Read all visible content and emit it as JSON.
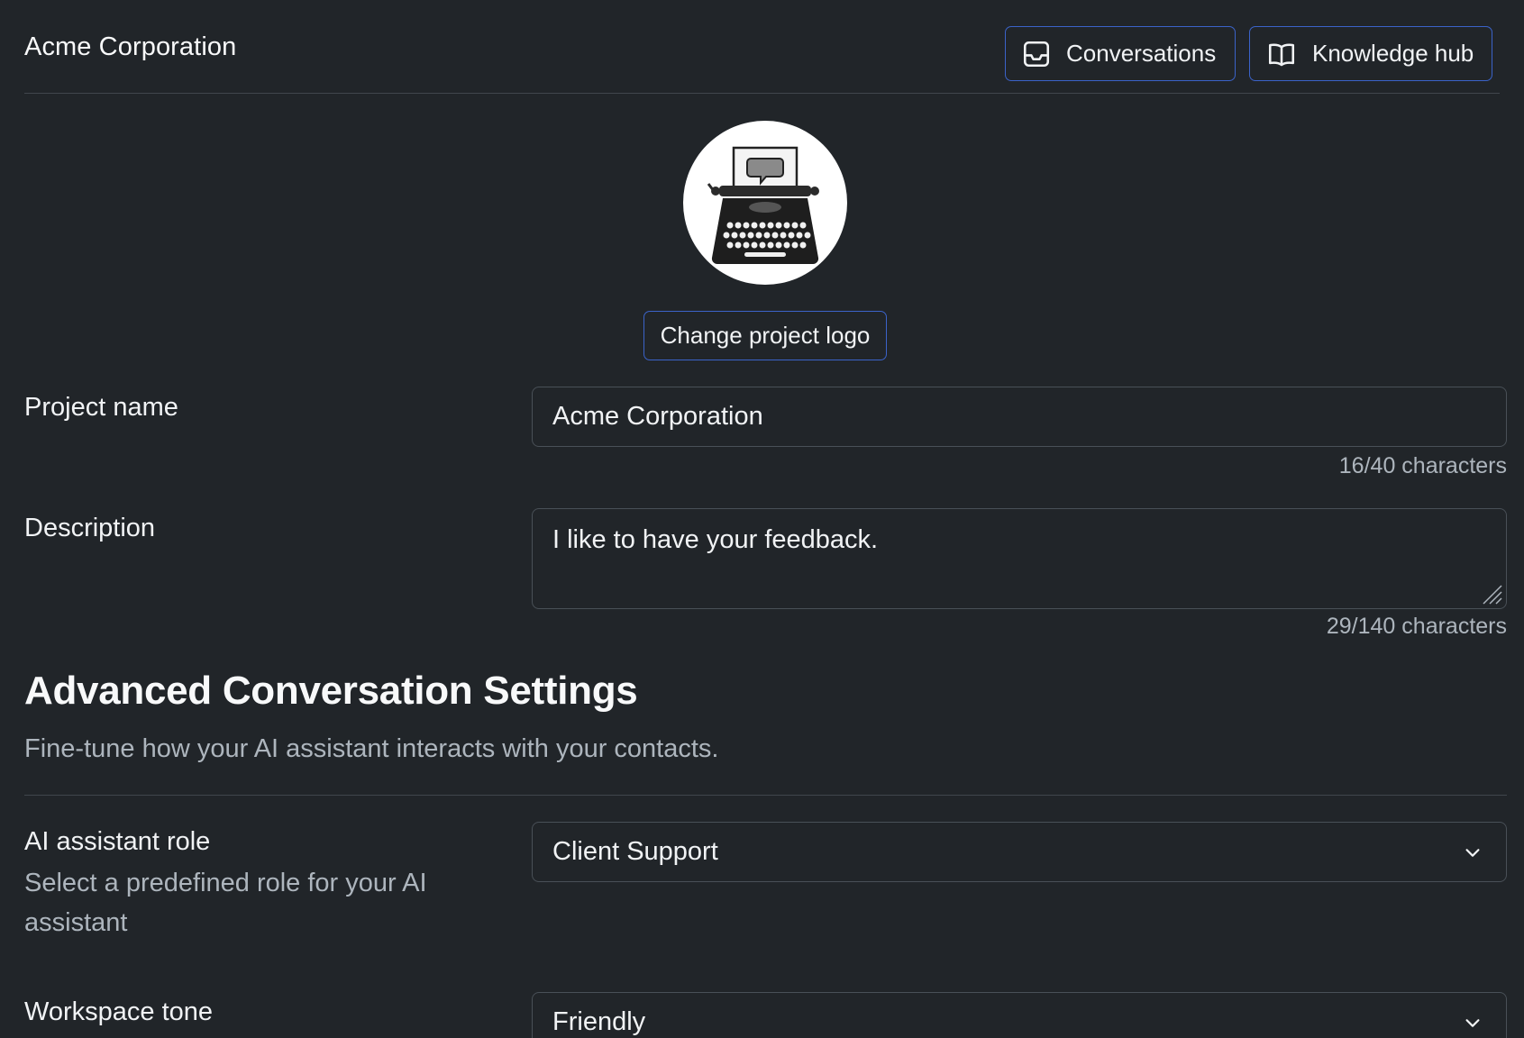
{
  "header": {
    "brand": "Acme Corporation",
    "nav": [
      {
        "label": "Conversations",
        "icon": "inbox-icon"
      },
      {
        "label": "Knowledge hub",
        "icon": "book-open-icon"
      }
    ]
  },
  "logo": {
    "icon": "typewriter-icon",
    "change_label": "Change project logo"
  },
  "project_name": {
    "label": "Project name",
    "value": "Acme Corporation",
    "counter": "16/40 characters"
  },
  "description": {
    "label": "Description",
    "value": "I like to have your feedback.",
    "counter": "29/140 characters"
  },
  "advanced": {
    "title": "Advanced Conversation Settings",
    "subtitle": "Fine-tune how your AI assistant interacts with your contacts.",
    "role": {
      "label": "AI assistant role",
      "help": "Select a predefined role for your AI assistant",
      "selected": "Client Support"
    },
    "tone": {
      "label": "Workspace tone",
      "selected": "Friendly"
    }
  },
  "colors": {
    "background": "#212529",
    "accent_border": "#3b63c9",
    "muted_text": "#adb5bd"
  }
}
